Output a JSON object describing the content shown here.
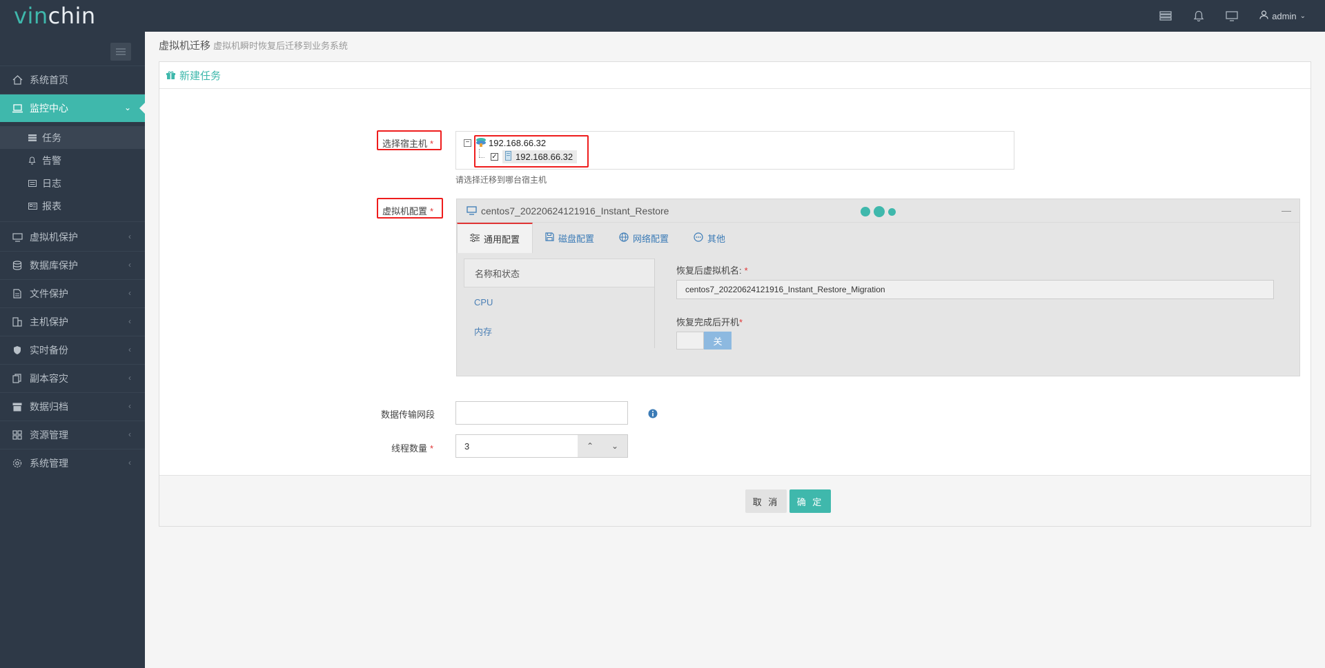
{
  "app": {
    "logo_part1": "vin",
    "logo_part2": "chin"
  },
  "topbar": {
    "user": "admin"
  },
  "sidebar": {
    "items": [
      {
        "label": "系统首页",
        "icon": "home-icon"
      },
      {
        "label": "监控中心",
        "icon": "monitor-icon",
        "active": true
      },
      {
        "label": "虚拟机保护",
        "icon": "vm-icon"
      },
      {
        "label": "数据库保护",
        "icon": "database-icon"
      },
      {
        "label": "文件保护",
        "icon": "file-icon"
      },
      {
        "label": "主机保护",
        "icon": "host-icon"
      },
      {
        "label": "实时备份",
        "icon": "shield-icon"
      },
      {
        "label": "副本容灾",
        "icon": "copy-icon"
      },
      {
        "label": "数据归档",
        "icon": "archive-icon"
      },
      {
        "label": "资源管理",
        "icon": "resource-icon"
      },
      {
        "label": "系统管理",
        "icon": "gear-icon"
      }
    ],
    "subitems": [
      {
        "label": "任务",
        "icon": "task-icon"
      },
      {
        "label": "告警",
        "icon": "bell-icon"
      },
      {
        "label": "日志",
        "icon": "log-icon"
      },
      {
        "label": "报表",
        "icon": "report-icon"
      }
    ]
  },
  "breadcrumb": {
    "title": "虚拟机迁移",
    "subtitle": "虚拟机瞬时恢复后迁移到业务系统"
  },
  "panel": {
    "title": "新建任务"
  },
  "form": {
    "host_label": "选择宿主机",
    "host_root": "192.168.66.32",
    "host_child": "192.168.66.32",
    "host_hint": "请选择迁移到哪台宿主机",
    "vm_label": "虚拟机配置",
    "vm_name_title": "centos7_20220624121916_Instant_Restore",
    "tabs": [
      "通用配置",
      "磁盘配置",
      "网络配置",
      "其他"
    ],
    "left_nav": [
      "名称和状态",
      "CPU",
      "内存"
    ],
    "restored_name_label": "恢复后虚拟机名:",
    "restored_name_value": "centos7_20220624121916_Instant_Restore_Migration",
    "power_on_label": "恢复完成后开机",
    "power_on_state": "关",
    "network_label": "数据传输网段",
    "network_value": "",
    "threads_label": "线程数量",
    "threads_value": "3",
    "required_mark": "*"
  },
  "buttons": {
    "cancel": "取 消",
    "ok": "确 定"
  },
  "colors": {
    "accent": "#3fb8ac",
    "sidebar_bg": "#2e3947",
    "highlight": "#ee1c1c"
  }
}
